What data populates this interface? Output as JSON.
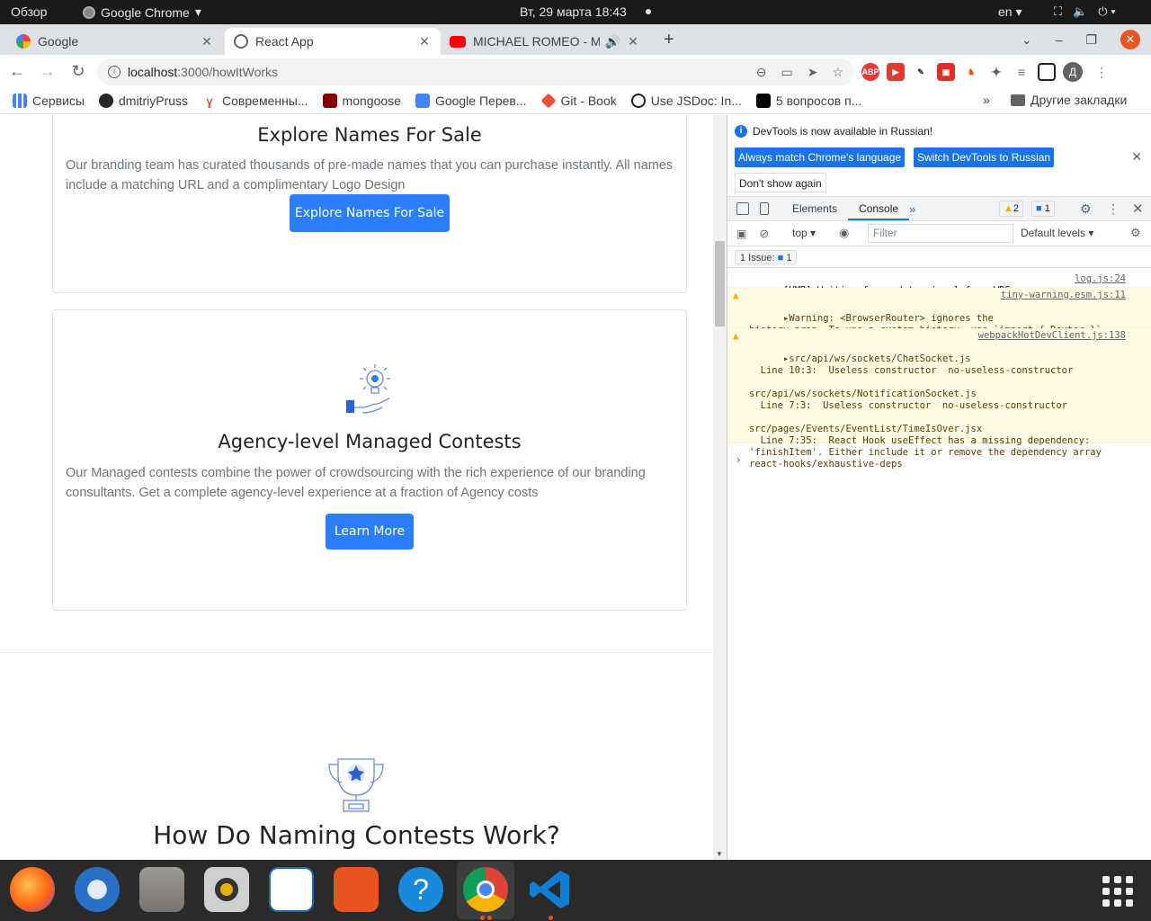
{
  "topbar": {
    "overview": "Обзор",
    "app_name": "Google Chrome",
    "clock": "Вт, 29 марта  18:43",
    "language": "en"
  },
  "tabs": [
    {
      "title": "Google",
      "favicon": "google-icon"
    },
    {
      "title": "React App",
      "favicon": "globe-icon"
    },
    {
      "title": "MICHAEL ROMEO - Me",
      "favicon": "youtube-icon"
    }
  ],
  "address": {
    "host": "localhost",
    "path": ":3000/howItWorks"
  },
  "bookmarks": [
    {
      "label": "Сервисы",
      "icon": "apps-icon",
      "color": "#4285f4"
    },
    {
      "label": "dmitriyPruss",
      "icon": "github-icon",
      "color": "#24292e"
    },
    {
      "label": "Современны...",
      "icon": "bookmark-icon",
      "color": "#d93025"
    },
    {
      "label": "mongoose",
      "icon": "mongoose-icon",
      "color": "#880000"
    },
    {
      "label": "Google Перев...",
      "icon": "translate-icon",
      "color": "#4285f4"
    },
    {
      "label": "Git - Book",
      "icon": "git-icon",
      "color": "#f05033"
    },
    {
      "label": "Use JSDoc: In...",
      "icon": "globe-icon",
      "color": "#202124"
    },
    {
      "label": "5 вопросов п...",
      "icon": "medium-icon",
      "color": "#000000"
    }
  ],
  "bookmarks_more": "»",
  "other_bookmarks": "Другие закладки",
  "page": {
    "card1": {
      "title": "Explore Names For Sale",
      "text": "Our branding team has curated thousands of pre-made names that you can purchase instantly. All names include a matching URL and a complimentary Logo Design",
      "button": "Explore Names For Sale"
    },
    "card2": {
      "title": "Agency-level Managed Contests",
      "text": "Our Managed contests combine the power of crowdsourcing with the rich experience of our branding consultants. Get a complete agency-level experience at a fraction of Agency costs",
      "button": "Learn More"
    },
    "section_title": "How Do Naming Contests Work?",
    "accent_color": "#2b7fff"
  },
  "devtools": {
    "notice": "DevTools is now available in Russian!",
    "btn_match": "Always match Chrome's language",
    "btn_switch": "Switch DevTools to Russian",
    "btn_dont_show": "Don't show again",
    "tab_elements": "Elements",
    "tab_console": "Console",
    "warnings_count": "2",
    "info_count": "1",
    "context": "top",
    "filter_placeholder": "Filter",
    "levels": "Default levels",
    "issues_label": "1 Issue:",
    "issues_count": "1",
    "messages": [
      {
        "text": "[HMR] Waiting for update signal from WDS...",
        "source": "log.js:24"
      },
      {
        "text": "▸Warning: <BrowserRouter> ignores the\nhistory prop. To use a custom history, use `import { Router }`\ninstead of `import { BrowserRouter as Router }`.",
        "source": "tiny-warning.esm.js:11"
      },
      {
        "text": "▸src/api/ws/sockets/ChatSocket.js\n  Line 10:3:  Useless constructor  no-useless-constructor\n\nsrc/api/ws/sockets/NotificationSocket.js\n  Line 7:3:  Useless constructor  no-useless-constructor\n\nsrc/pages/Events/EventList/TimeIsOver.jsx\n  Line 7:35:  React Hook useEffect has a missing dependency:\n'finishItem'. Either include it or remove the dependency array\nreact-hooks/exhaustive-deps",
        "source": "webpackHotDevClient.js:138"
      }
    ],
    "prompt": "›"
  },
  "dock": [
    "firefox-icon",
    "thunderbird-icon",
    "files-icon",
    "rhythmbox-icon",
    "writer-icon",
    "software-icon",
    "help-icon",
    "chrome-icon",
    "vscode-icon",
    "app-grid-icon"
  ]
}
